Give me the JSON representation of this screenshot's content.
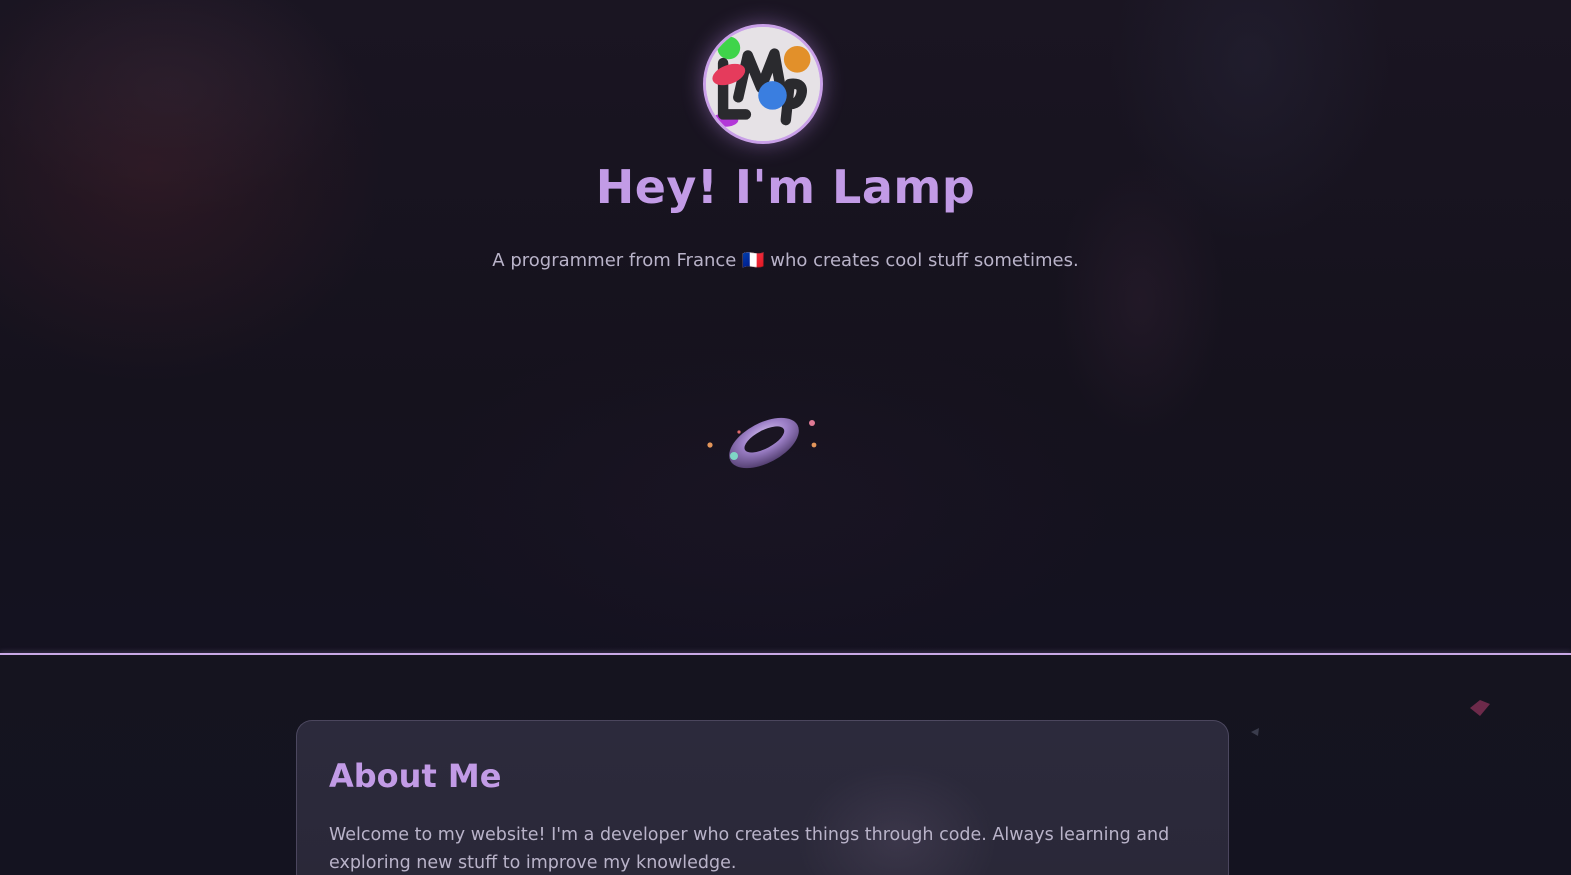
{
  "hero": {
    "avatar_label": "LMP",
    "title": "Hey! I'm Lamp",
    "subtitle": "A programmer from France 🇫🇷 who creates cool stuff sometimes."
  },
  "about": {
    "title": "About Me",
    "text": "Welcome to my website! I'm a developer who creates things through code. Always learning and exploring new stuff to improve my knowledge."
  },
  "colors": {
    "accent": "#c29be6",
    "background": "#13121c",
    "card": "#2c2a3c",
    "text": "#b9b3c9",
    "divider": "#c9a9e6"
  },
  "icons": {
    "hero_visual": "torus-3d-icon",
    "decorations": [
      "diamond-shape-icon",
      "triangle-shape-icon"
    ]
  }
}
